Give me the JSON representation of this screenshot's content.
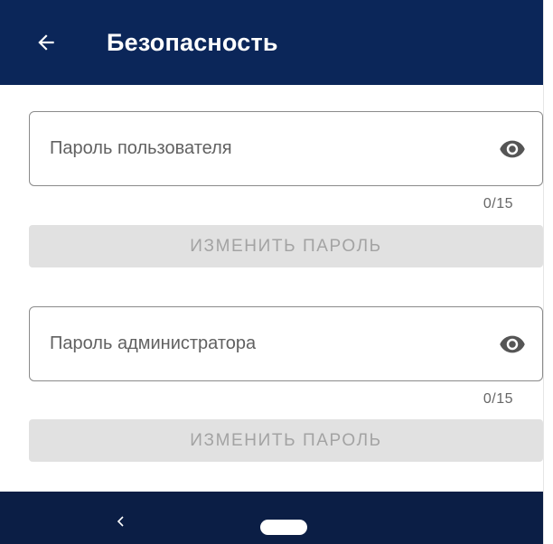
{
  "app_bar": {
    "title": "Безопасность",
    "back_icon": "arrow-left-icon",
    "background": "#0b2659"
  },
  "user_password": {
    "placeholder": "Пароль пользователя",
    "value": "",
    "counter": "0/15",
    "toggle_icon": "eye-icon",
    "button_label": "ИЗМЕНИТЬ ПАРОЛЬ"
  },
  "admin_password": {
    "placeholder": "Пароль администратора",
    "value": "",
    "counter": "0/15",
    "toggle_icon": "eye-icon",
    "button_label": "ИЗМЕНИТЬ ПАРОЛЬ"
  },
  "button_style": {
    "background": "#e1e1e1",
    "text_color": "#a3a3a3",
    "state": "disabled"
  },
  "nav_bar": {
    "back_icon": "chevron-left-icon",
    "home_icon": "home-pill-icon",
    "background": "#0b1e45"
  }
}
